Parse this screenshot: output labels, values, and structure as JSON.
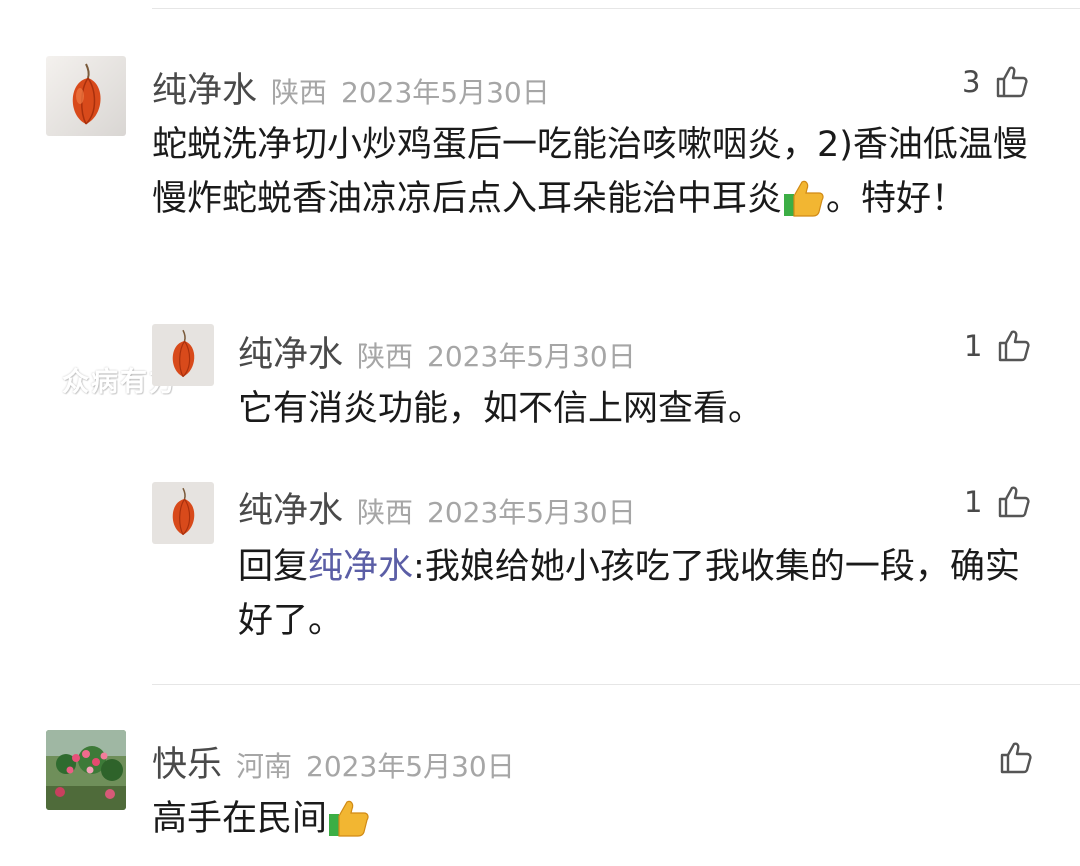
{
  "comments": [
    {
      "user": "纯净水",
      "region": "陕西",
      "date": "2023年5月30日",
      "likes": "3",
      "avatar": "physalis-lantern",
      "text_part1": "蛇蜕洗净切小炒鸡蛋后一吃能治咳嗽咽炎，2)香油低温慢慢炸蛇蜕香油凉凉后点入耳朵能治中耳炎",
      "text_part2": "。特好！"
    }
  ],
  "replies": [
    {
      "user": "纯净水",
      "region": "陕西",
      "date": "2023年5月30日",
      "likes": "1",
      "avatar": "physalis-lantern",
      "text": "它有消炎功能，如不信上网查看。"
    },
    {
      "user": "纯净水",
      "region": "陕西",
      "date": "2023年5月30日",
      "likes": "1",
      "avatar": "physalis-lantern",
      "reply_prefix": "回复",
      "mention": "纯净水",
      "text": ":我娘给她小孩吃了我收集的一段，确实好了。"
    }
  ],
  "comment2": {
    "user": "快乐",
    "region": "河南",
    "date": "2023年5月30日",
    "avatar": "flower-garden",
    "text": "高手在民间"
  },
  "watermark": "众病有方",
  "icons": {
    "like": "thumbs-up-outline-icon",
    "emoji": "thumbs-up-emoji-icon"
  },
  "colors": {
    "username": "#4a4a4a",
    "meta": "#a6a6a6",
    "mention": "#5b5ea6",
    "text": "#1a1a1a"
  }
}
